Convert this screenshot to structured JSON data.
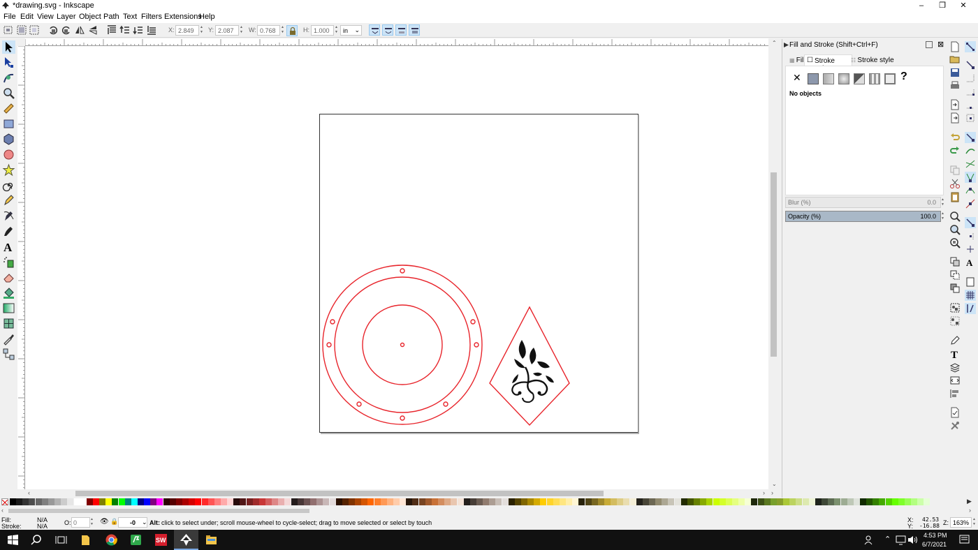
{
  "window": {
    "title": "*drawing.svg - Inkscape",
    "minimize": "–",
    "maximize": "❒",
    "close": "✕"
  },
  "menu": [
    "File",
    "Edit",
    "View",
    "Layer",
    "Object",
    "Path",
    "Text",
    "Filters",
    "Extensions",
    "Help"
  ],
  "toolbar": {
    "x_label": "X:",
    "x_value": "2.849",
    "y_label": "Y:",
    "y_value": "2.087",
    "w_label": "W:",
    "w_value": "0.768",
    "h_label": "H:",
    "h_value": "1.000",
    "unit": "in"
  },
  "panel": {
    "title": "Fill and Stroke (Shift+Ctrl+F)",
    "tab_fill": "Fill",
    "tab_stroke_paint": "Stroke paint",
    "tab_stroke_style": "Stroke style",
    "unknown_paint": "?",
    "no_paint": "✕",
    "no_objects": "No objects",
    "blur_label": "Blur (%)",
    "blur_value": "0.0",
    "opacity_label": "Opacity (%)",
    "opacity_value": "100.0",
    "opacity_level": 1.0
  },
  "status": {
    "fill_label": "Fill:",
    "fill_value": "N/A",
    "stroke_label": "Stroke:",
    "stroke_value": "N/A",
    "o_label": "O:",
    "o_value": "0",
    "layer_value": "-0",
    "message_bold": "Alt:",
    "message": " click to select under; scroll mouse-wheel to cycle-select; drag to move selected or select by touch",
    "x_label": "X:",
    "x_value": "42.53",
    "y_label": "Y:",
    "y_value": "-16.88",
    "z_label": "Z:",
    "zoom": "163%"
  },
  "taskbar": {
    "time": "4:53 PM",
    "date": "6/7/2021"
  },
  "colors": {
    "accent": "#cce4f7",
    "outline_red": "#e8242b"
  }
}
